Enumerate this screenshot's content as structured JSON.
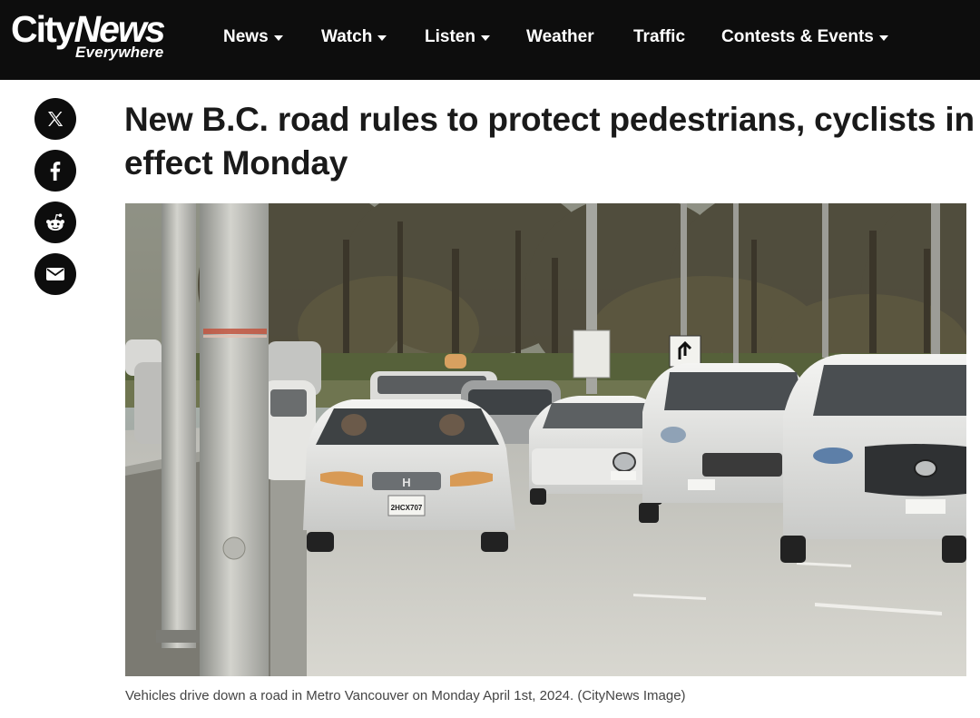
{
  "brand": {
    "logo_main_city": "City",
    "logo_main_news": "News",
    "logo_sub": "Everywhere"
  },
  "nav": {
    "items": [
      {
        "label": "News",
        "dropdown": true
      },
      {
        "label": "Watch",
        "dropdown": true
      },
      {
        "label": "Listen",
        "dropdown": true
      },
      {
        "label": "Weather",
        "dropdown": false
      },
      {
        "label": "Traffic",
        "dropdown": false
      },
      {
        "label": "Contests & Events",
        "dropdown": true
      }
    ]
  },
  "share": {
    "buttons": [
      {
        "icon": "x-icon"
      },
      {
        "icon": "facebook-icon"
      },
      {
        "icon": "reddit-icon"
      },
      {
        "icon": "email-icon"
      }
    ]
  },
  "article": {
    "headline": "New B.C. road rules to protect pedestrians, cyclists in effect Monday",
    "image_caption": "Vehicles drive down a road in Metro Vancouver on Monday April 1st, 2024. (CityNews Image)"
  },
  "photo_plates": {
    "honda": "2HCX707"
  },
  "colors": {
    "nav_background": "#0d0d0d",
    "nav_text": "#ffffff",
    "headline": "#1a1a1a",
    "caption": "#444444"
  }
}
